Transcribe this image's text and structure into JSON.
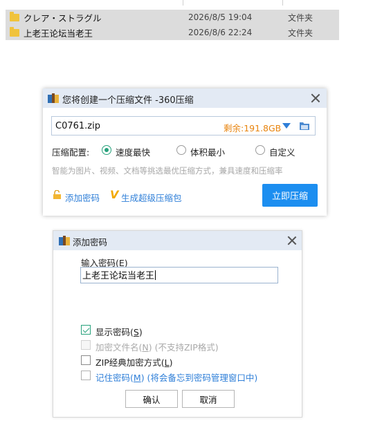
{
  "files": [
    {
      "name": "クレア・ストラグル",
      "date": "2026/8/5 19:04",
      "type": "文件夹"
    },
    {
      "name": "上老王论坛当老王",
      "date": "2026/8/6 22:24",
      "type": "文件夹"
    }
  ],
  "compress_dialog": {
    "title": "您将创建一个压缩文件 -360压缩",
    "filename": "C0761.zip",
    "remaining": "剩余:191.8GB",
    "config_label": "压缩配置:",
    "options": [
      "速度最快",
      "体积最小",
      "自定义"
    ],
    "selected_option": "速度最快",
    "hint": "智能为图片、视频、文档等挑选最优压缩方式，兼具速度和压缩率",
    "add_password_link": "添加密码",
    "super_pack_link": "生成超级压缩包",
    "compress_button": "立即压缩"
  },
  "password_dialog": {
    "title": "添加密码",
    "input_label_prefix": "输入密码(",
    "input_label_key": "E",
    "input_label_suffix": ")",
    "password_value": "上老王论坛当老王",
    "show_password_prefix": "显示密码(",
    "show_password_key": "S",
    "show_password_suffix": ")",
    "encrypt_names_prefix": "加密文件名(",
    "encrypt_names_key": "N",
    "encrypt_names_suffix": ") (不支持ZIP格式)",
    "zip_classic_prefix": "ZIP经典加密方式(",
    "zip_classic_key": "L",
    "zip_classic_suffix": ")",
    "remember_prefix": "记住密码(",
    "remember_key": "M",
    "remember_suffix": ") (将会备忘到密码管理窗口中)",
    "ok_label": "确认",
    "cancel_label": "取消",
    "show_password_checked": true
  },
  "colors": {
    "accent": "#1c8ef0",
    "remaining_orange": "#e8840e",
    "link_blue": "#2f7fd8",
    "check_green": "#26a17b"
  }
}
